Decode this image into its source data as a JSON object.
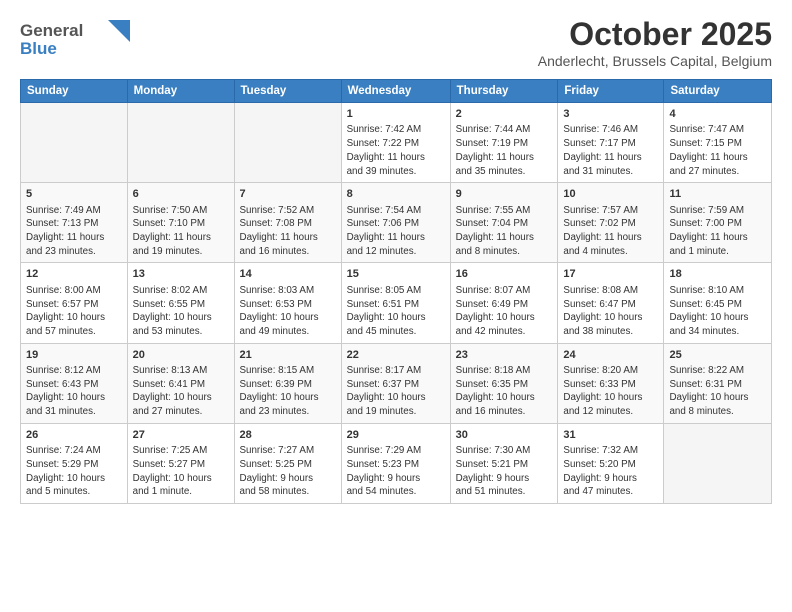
{
  "header": {
    "logo_line1": "General",
    "logo_line2": "Blue",
    "month_title": "October 2025",
    "location": "Anderlecht, Brussels Capital, Belgium"
  },
  "days_of_week": [
    "Sunday",
    "Monday",
    "Tuesday",
    "Wednesday",
    "Thursday",
    "Friday",
    "Saturday"
  ],
  "weeks": [
    [
      {
        "num": "",
        "info": ""
      },
      {
        "num": "",
        "info": ""
      },
      {
        "num": "",
        "info": ""
      },
      {
        "num": "1",
        "info": "Sunrise: 7:42 AM\nSunset: 7:22 PM\nDaylight: 11 hours\nand 39 minutes."
      },
      {
        "num": "2",
        "info": "Sunrise: 7:44 AM\nSunset: 7:19 PM\nDaylight: 11 hours\nand 35 minutes."
      },
      {
        "num": "3",
        "info": "Sunrise: 7:46 AM\nSunset: 7:17 PM\nDaylight: 11 hours\nand 31 minutes."
      },
      {
        "num": "4",
        "info": "Sunrise: 7:47 AM\nSunset: 7:15 PM\nDaylight: 11 hours\nand 27 minutes."
      }
    ],
    [
      {
        "num": "5",
        "info": "Sunrise: 7:49 AM\nSunset: 7:13 PM\nDaylight: 11 hours\nand 23 minutes."
      },
      {
        "num": "6",
        "info": "Sunrise: 7:50 AM\nSunset: 7:10 PM\nDaylight: 11 hours\nand 19 minutes."
      },
      {
        "num": "7",
        "info": "Sunrise: 7:52 AM\nSunset: 7:08 PM\nDaylight: 11 hours\nand 16 minutes."
      },
      {
        "num": "8",
        "info": "Sunrise: 7:54 AM\nSunset: 7:06 PM\nDaylight: 11 hours\nand 12 minutes."
      },
      {
        "num": "9",
        "info": "Sunrise: 7:55 AM\nSunset: 7:04 PM\nDaylight: 11 hours\nand 8 minutes."
      },
      {
        "num": "10",
        "info": "Sunrise: 7:57 AM\nSunset: 7:02 PM\nDaylight: 11 hours\nand 4 minutes."
      },
      {
        "num": "11",
        "info": "Sunrise: 7:59 AM\nSunset: 7:00 PM\nDaylight: 11 hours\nand 1 minute."
      }
    ],
    [
      {
        "num": "12",
        "info": "Sunrise: 8:00 AM\nSunset: 6:57 PM\nDaylight: 10 hours\nand 57 minutes."
      },
      {
        "num": "13",
        "info": "Sunrise: 8:02 AM\nSunset: 6:55 PM\nDaylight: 10 hours\nand 53 minutes."
      },
      {
        "num": "14",
        "info": "Sunrise: 8:03 AM\nSunset: 6:53 PM\nDaylight: 10 hours\nand 49 minutes."
      },
      {
        "num": "15",
        "info": "Sunrise: 8:05 AM\nSunset: 6:51 PM\nDaylight: 10 hours\nand 45 minutes."
      },
      {
        "num": "16",
        "info": "Sunrise: 8:07 AM\nSunset: 6:49 PM\nDaylight: 10 hours\nand 42 minutes."
      },
      {
        "num": "17",
        "info": "Sunrise: 8:08 AM\nSunset: 6:47 PM\nDaylight: 10 hours\nand 38 minutes."
      },
      {
        "num": "18",
        "info": "Sunrise: 8:10 AM\nSunset: 6:45 PM\nDaylight: 10 hours\nand 34 minutes."
      }
    ],
    [
      {
        "num": "19",
        "info": "Sunrise: 8:12 AM\nSunset: 6:43 PM\nDaylight: 10 hours\nand 31 minutes."
      },
      {
        "num": "20",
        "info": "Sunrise: 8:13 AM\nSunset: 6:41 PM\nDaylight: 10 hours\nand 27 minutes."
      },
      {
        "num": "21",
        "info": "Sunrise: 8:15 AM\nSunset: 6:39 PM\nDaylight: 10 hours\nand 23 minutes."
      },
      {
        "num": "22",
        "info": "Sunrise: 8:17 AM\nSunset: 6:37 PM\nDaylight: 10 hours\nand 19 minutes."
      },
      {
        "num": "23",
        "info": "Sunrise: 8:18 AM\nSunset: 6:35 PM\nDaylight: 10 hours\nand 16 minutes."
      },
      {
        "num": "24",
        "info": "Sunrise: 8:20 AM\nSunset: 6:33 PM\nDaylight: 10 hours\nand 12 minutes."
      },
      {
        "num": "25",
        "info": "Sunrise: 8:22 AM\nSunset: 6:31 PM\nDaylight: 10 hours\nand 8 minutes."
      }
    ],
    [
      {
        "num": "26",
        "info": "Sunrise: 7:24 AM\nSunset: 5:29 PM\nDaylight: 10 hours\nand 5 minutes."
      },
      {
        "num": "27",
        "info": "Sunrise: 7:25 AM\nSunset: 5:27 PM\nDaylight: 10 hours\nand 1 minute."
      },
      {
        "num": "28",
        "info": "Sunrise: 7:27 AM\nSunset: 5:25 PM\nDaylight: 9 hours\nand 58 minutes."
      },
      {
        "num": "29",
        "info": "Sunrise: 7:29 AM\nSunset: 5:23 PM\nDaylight: 9 hours\nand 54 minutes."
      },
      {
        "num": "30",
        "info": "Sunrise: 7:30 AM\nSunset: 5:21 PM\nDaylight: 9 hours\nand 51 minutes."
      },
      {
        "num": "31",
        "info": "Sunrise: 7:32 AM\nSunset: 5:20 PM\nDaylight: 9 hours\nand 47 minutes."
      },
      {
        "num": "",
        "info": ""
      }
    ]
  ]
}
